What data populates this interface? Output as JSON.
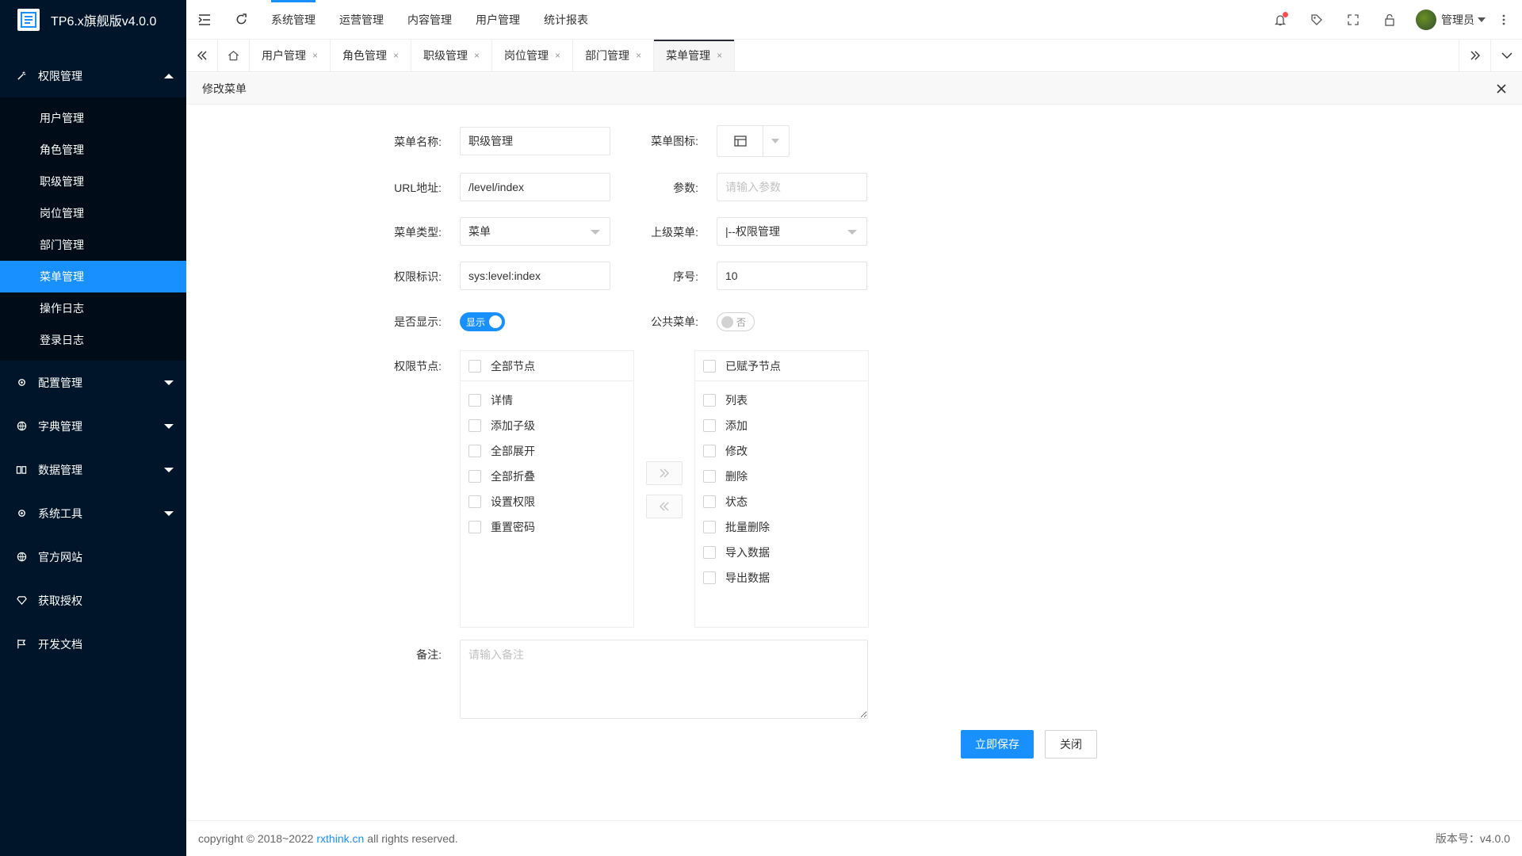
{
  "app": {
    "title": "TP6.x旗舰版v4.0.0"
  },
  "sidebar": {
    "groups": [
      {
        "label": "权限管理",
        "icon": "wand-icon",
        "open": true
      },
      {
        "label": "配置管理",
        "icon": "gear-icon"
      },
      {
        "label": "字典管理",
        "icon": "globe-icon"
      },
      {
        "label": "数据管理",
        "icon": "book-icon"
      },
      {
        "label": "系统工具",
        "icon": "gear-icon"
      },
      {
        "label": "官方网站",
        "icon": "globe-icon"
      },
      {
        "label": "获取授权",
        "icon": "diamond-icon"
      },
      {
        "label": "开发文档",
        "icon": "flag-icon"
      }
    ],
    "items": [
      "用户管理",
      "角色管理",
      "职级管理",
      "岗位管理",
      "部门管理",
      "菜单管理",
      "操作日志",
      "登录日志"
    ],
    "active_item": "菜单管理"
  },
  "header": {
    "nav": [
      "系统管理",
      "运营管理",
      "内容管理",
      "用户管理",
      "统计报表"
    ],
    "user": "管理员"
  },
  "tabs": {
    "items": [
      "用户管理",
      "角色管理",
      "职级管理",
      "岗位管理",
      "部门管理",
      "菜单管理"
    ],
    "active": "菜单管理",
    "close": "×"
  },
  "panel": {
    "title": "修改菜单"
  },
  "form": {
    "name_label": "菜单名称:",
    "name_value": "职级管理",
    "icon_label": "菜单图标:",
    "url_label": "URL地址:",
    "url_value": "/level/index",
    "param_label": "参数:",
    "param_placeholder": "请输入参数",
    "type_label": "菜单类型:",
    "type_value": "菜单",
    "parent_label": "上级菜单:",
    "parent_value": "|--权限管理",
    "perm_label": "权限标识:",
    "perm_value": "sys:level:index",
    "sort_label": "序号:",
    "sort_value": "10",
    "show_label": "是否显示:",
    "show_switch": "显示",
    "public_label": "公共菜单:",
    "public_switch": "否",
    "nodes_label": "权限节点:",
    "left_title": "全部节点",
    "left_items": [
      "详情",
      "添加子级",
      "全部展开",
      "全部折叠",
      "设置权限",
      "重置密码"
    ],
    "right_title": "已赋予节点",
    "right_items": [
      "列表",
      "添加",
      "修改",
      "删除",
      "状态",
      "批量删除",
      "导入数据",
      "导出数据"
    ],
    "note_label": "备注:",
    "note_placeholder": "请输入备注",
    "save_label": "立即保存",
    "close_label": "关闭"
  },
  "footer": {
    "copyright_pre": "copyright © 2018~2022",
    "link": "rxthink.cn",
    "copyright_post": "all rights reserved.",
    "version": "版本号：v4.0.0"
  },
  "colors": {
    "sidebar": "#001529",
    "accent": "#1890ff",
    "alert_dot": "#ff4d4f"
  }
}
